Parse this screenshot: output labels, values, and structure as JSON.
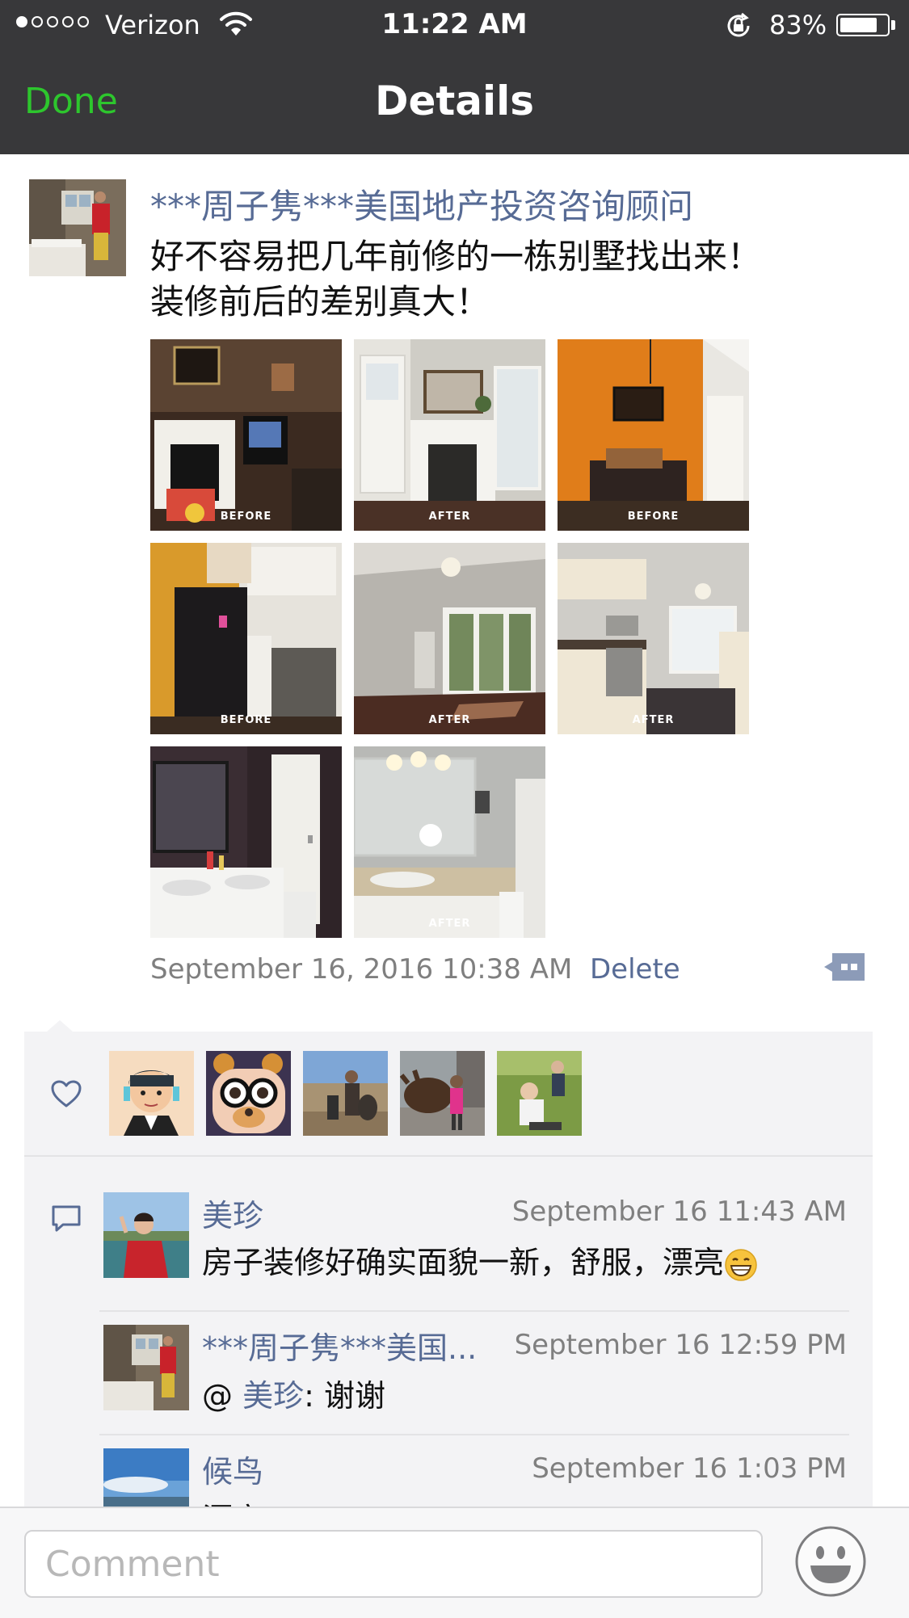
{
  "status_bar": {
    "carrier": "Verizon",
    "time": "11:22 AM",
    "battery": "83%",
    "battery_level": 0.83
  },
  "nav": {
    "done_label": "Done",
    "title": "Details"
  },
  "post": {
    "author": "***周子隽***美国地产投资咨询顾问",
    "text_line1": "好不容易把几年前修的一栋别墅找出来！",
    "text_line2": "装修前后的差别真大！",
    "photos": [
      {
        "caption": "BEFORE"
      },
      {
        "caption": "AFTER"
      },
      {
        "caption": "BEFORE"
      },
      {
        "caption": "BEFORE"
      },
      {
        "caption": "AFTER"
      },
      {
        "caption": "AFTER"
      },
      {
        "caption": ""
      },
      {
        "caption": "AFTER"
      }
    ],
    "timestamp": "September 16, 2016 10:38 AM",
    "delete_label": "Delete"
  },
  "comments": [
    {
      "name": "美珍",
      "time": "September 16 11:43 AM",
      "text": "房子装修好确实面貌一新，舒服，漂亮"
    },
    {
      "name": "***周子隽***美国...",
      "time": "September 16 12:59 PM",
      "prefix": "@ ",
      "mention": "美珍",
      "text": ": 谢谢"
    },
    {
      "name": "候鸟",
      "time": "September 16 1:03 PM",
      "text": "漂亮"
    }
  ],
  "input": {
    "placeholder": "Comment"
  },
  "colors": {
    "link": "#576b95",
    "done": "#2dc62d",
    "nav_bg": "#38383a",
    "panel_bg": "#f3f3f5"
  }
}
